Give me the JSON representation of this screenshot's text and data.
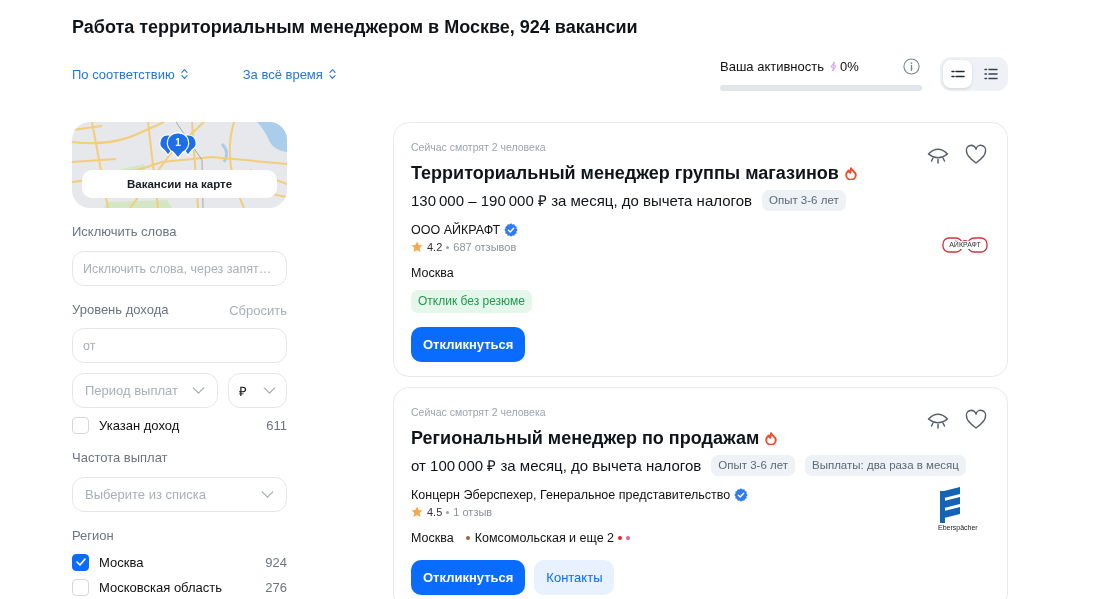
{
  "page_title": "Работа территориальным менеджером в Москве, 924 вакансии",
  "sort_options": [
    {
      "label": "По соответствию"
    },
    {
      "label": "За всё время"
    }
  ],
  "activity": {
    "label": "Ваша активность",
    "value": "0%",
    "level": 0
  },
  "view_modes": [
    {
      "kind": "compact",
      "selected": true
    },
    {
      "kind": "detailed",
      "selected": false
    }
  ],
  "sidebar": {
    "map": {
      "pin_count": "1",
      "button": "Вакансии на карте"
    },
    "exclude_words": {
      "label": "Исключить слова",
      "placeholder": "Исключить слова, через запят…"
    },
    "income": {
      "label": "Уровень дохода",
      "reset": "Сбросить",
      "placeholder": "от",
      "period_placeholder": "Период выплат",
      "currency": "₽",
      "salary_specified": {
        "label": "Указан доход",
        "count": "611",
        "checked": false
      }
    },
    "pay_frequency": {
      "label": "Частота выплат",
      "placeholder": "Выберите из списка"
    },
    "region": {
      "label": "Регион",
      "options": [
        {
          "label": "Москва",
          "count": "924",
          "checked": true
        },
        {
          "label": "Московская область",
          "count": "276",
          "checked": false
        }
      ]
    }
  },
  "vacancies": [
    {
      "viewers": "Сейчас смотрят 2 человека",
      "title": "Территориальный менеджер группы магазинов",
      "hot": true,
      "salary": "130 000 – 190 000 ₽ за месяц, до вычета налогов",
      "tags": [
        "Опыт 3-6 лет"
      ],
      "company": "ООО АЙКРАФТ",
      "verified": true,
      "rating": "4.2",
      "reviews": "687 отзывов",
      "logo": {
        "kind": "glasses",
        "text": "АЙКРАФТ"
      },
      "location": {
        "city": "Москва"
      },
      "badges": [
        "Отклик без резюме"
      ],
      "buttons": [
        {
          "kind": "primary",
          "label": "Откликнуться"
        }
      ]
    },
    {
      "viewers": "Сейчас смотрят 2 человека",
      "title": "Региональный менеджер по продажам",
      "hot": true,
      "salary": "от 100 000 ₽ за месяц, до вычета налогов",
      "tags": [
        "Опыт 3-6 лет",
        "Выплаты: два раза в месяц"
      ],
      "company": "Концерн Эберспехер, Генеральное представительство",
      "verified": true,
      "rating": "4.5",
      "reviews": "1 отзыв",
      "logo": {
        "kind": "stripes",
        "text": "Eberspächer"
      },
      "location": {
        "city": "Москва",
        "line_dots": [
          {
            "color": "#a0643c"
          }
        ],
        "station": "Комсомольская и еще 2",
        "more_dots": [
          {
            "color": "#e5262b"
          },
          {
            "color": "#ef5a8a"
          }
        ]
      },
      "buttons": [
        {
          "kind": "primary",
          "label": "Откликнуться"
        },
        {
          "kind": "secondary",
          "label": "Контакты"
        }
      ]
    }
  ]
}
